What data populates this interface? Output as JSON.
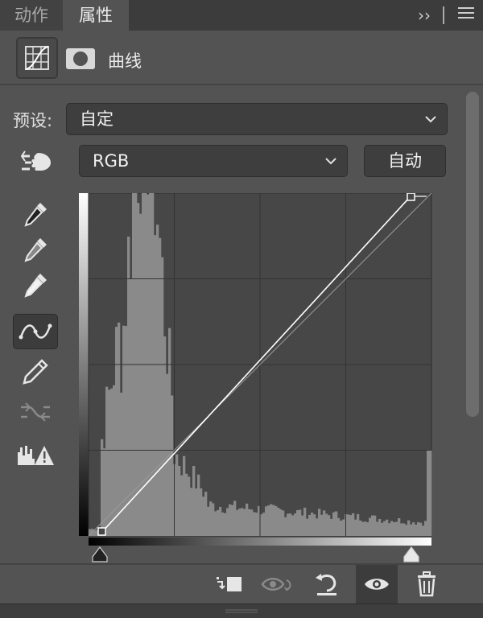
{
  "tabs": [
    {
      "label": "动作",
      "active": false
    },
    {
      "label": "属性",
      "active": true
    }
  ],
  "tab_controls": {
    "expand_glyph": "››"
  },
  "header": {
    "title": "曲线"
  },
  "preset": {
    "label": "预设:",
    "value": "自定"
  },
  "channel": {
    "value": "RGB"
  },
  "auto_button": {
    "label": "自动"
  },
  "tools": [
    "target-adjust-hand-icon",
    "black-point-eyedropper-icon",
    "gray-point-eyedropper-icon",
    "white-point-eyedropper-icon",
    "curve-point-icon",
    "pencil-icon",
    "smooth-curve-icon",
    "clipping-warning-icon"
  ],
  "curve": {
    "points": [
      [
        0,
        0
      ],
      [
        255,
        255
      ]
    ],
    "grid_divisions": 4
  },
  "bottom_tools": [
    "clip-to-layer-icon",
    "view-previous-state-icon",
    "reset-icon",
    "visibility-icon",
    "delete-icon"
  ],
  "colors": {
    "panel": "#535353",
    "dark": "#3c3c3c",
    "curve": "#ffffff",
    "histogram": "#8a8a8a"
  }
}
